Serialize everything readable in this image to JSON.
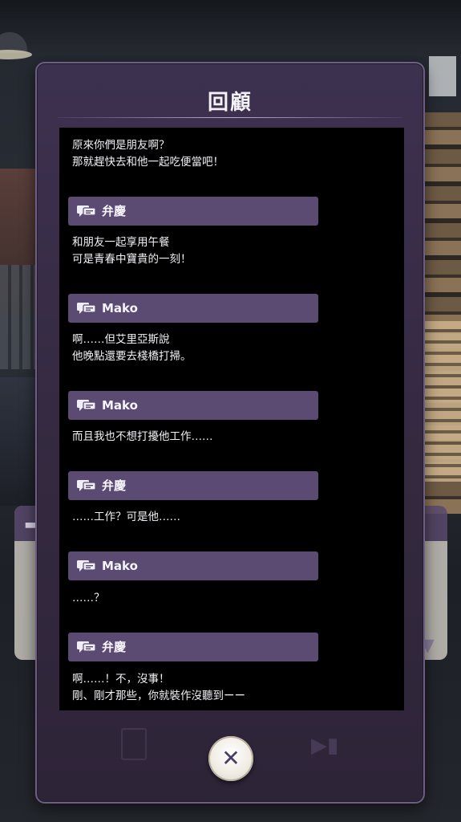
{
  "backlog": {
    "title": "回顧",
    "entries": [
      {
        "speaker": null,
        "lines": [
          "原來你們是朋友啊？",
          "那就趕快去和他一起吃便當吧！"
        ]
      },
      {
        "speaker": "弁慶",
        "lines": [
          "和朋友一起享用午餐",
          "可是青春中寶貴的一刻！"
        ]
      },
      {
        "speaker": "Mako",
        "lines": [
          "啊……但艾里亞斯說",
          "他晚點還要去棧橋打掃。"
        ]
      },
      {
        "speaker": "Mako",
        "lines": [
          "而且我也不想打擾他工作……"
        ]
      },
      {
        "speaker": "弁慶",
        "lines": [
          "……工作？可是他……"
        ]
      },
      {
        "speaker": "Mako",
        "lines": [
          "……？"
        ]
      },
      {
        "speaker": "弁慶",
        "lines": [
          "啊……！不，沒事！",
          "剛、剛才那些，你就裝作沒聽到ーー"
        ]
      }
    ]
  },
  "icons": {
    "speaker": "chat-bubble-icon",
    "close": "close-icon",
    "scroll": "chevron-down-icon"
  },
  "colors": {
    "panel": "#3d3150",
    "name_bar": "#5b4b73",
    "log_background": "#000000",
    "text": "#f2f0f5"
  }
}
